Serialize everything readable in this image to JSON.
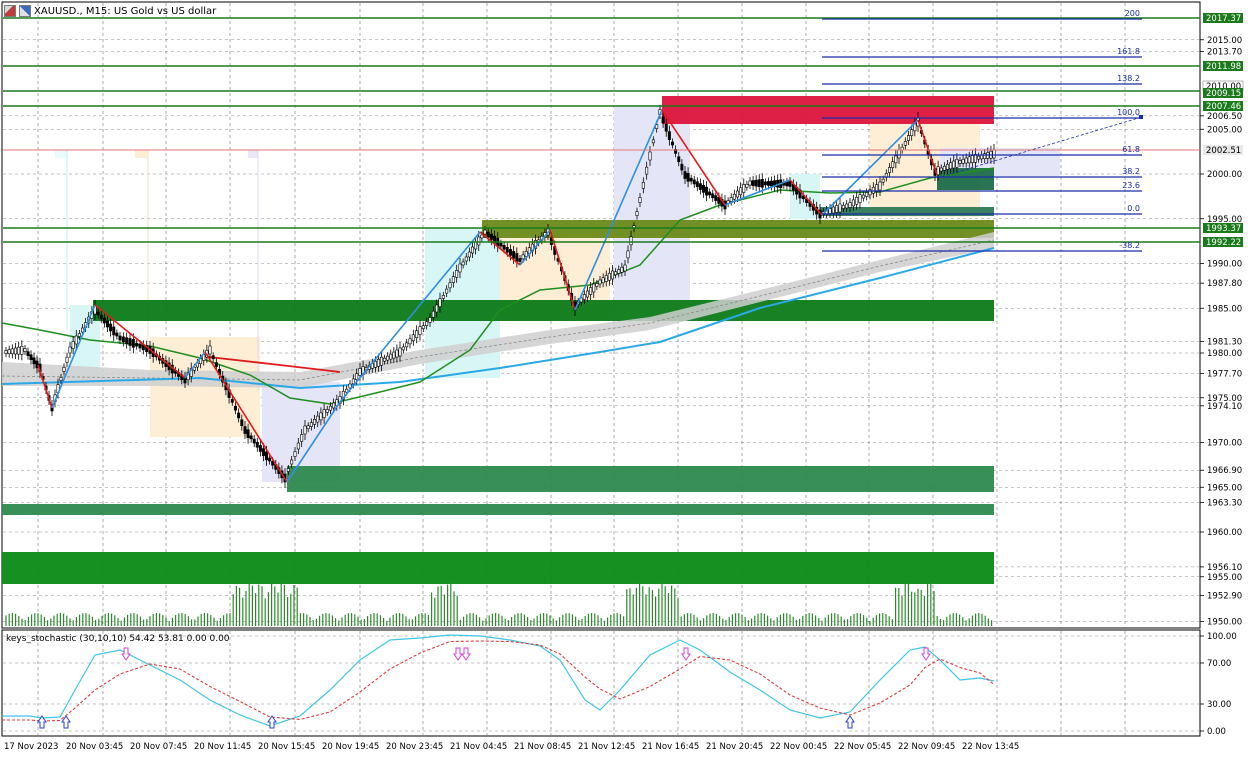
{
  "header": {
    "title": "XAUUSD., M15:  US Gold vs US dollar"
  },
  "price_axis": {
    "labels": [
      "2015.00",
      "2013.70",
      "2006.50",
      "2005.00",
      "2000.00",
      "1995.00",
      "1990.00",
      "1987.80",
      "1985.00",
      "1981.30",
      "1980.00",
      "1977.70",
      "1975.00",
      "1974.10",
      "1970.00",
      "1966.90",
      "1965.00",
      "1963.30",
      "1960.00",
      "1956.10",
      "1955.00",
      "1952.90",
      "1950.00"
    ],
    "highlights": [
      {
        "label": "2017.37",
        "color": "#1b7a1b"
      },
      {
        "label": "2011.98",
        "color": "#1b7a1b"
      },
      {
        "label": "2010.00",
        "color": "#ffffff"
      },
      {
        "label": "2009.15",
        "color": "#1b7a1b"
      },
      {
        "label": "2007.46",
        "color": "#1b7a1b"
      },
      {
        "label": "2002.51",
        "color": "#e8e8e8"
      },
      {
        "label": "1993.37",
        "color": "#1b7a1b"
      },
      {
        "label": "1992.22",
        "color": "#1b7a1b"
      }
    ]
  },
  "time_axis": [
    "17 Nov 2023",
    "20 Nov 03:45",
    "20 Nov 07:45",
    "20 Nov 11:45",
    "20 Nov 15:45",
    "20 Nov 19:45",
    "20 Nov 23:45",
    "21 Nov 04:45",
    "21 Nov 08:45",
    "21 Nov 12:45",
    "21 Nov 16:45",
    "21 Nov 20:45",
    "22 Nov 00:45",
    "22 Nov 05:45",
    "22 Nov 09:45",
    "22 Nov 13:45"
  ],
  "fib_levels": [
    "200",
    "161.8",
    "138.2",
    "100.0",
    "61.8",
    "38.2",
    "23.6",
    "0.0",
    "-38.2"
  ],
  "indicator": {
    "label": "keys_stochastic (30,10,10) 54.42 53.81 0.00 0.00",
    "axis": [
      "100.00",
      "70.00",
      "30.00",
      "0.00"
    ]
  },
  "colors": {
    "bull": "#1a1a1a",
    "zigzag_up": "#2f8fe0",
    "zigzag_down": "#e01b1b",
    "ma_fast": "#1e8f1e",
    "ma_slow": "#2aa8e8",
    "zone_green": "#0a7a14",
    "zone_red": "#dc143c",
    "fib": "#1a2ea8",
    "stoch_k": "#3fc6e6",
    "stoch_d": "#e23b3b"
  }
}
